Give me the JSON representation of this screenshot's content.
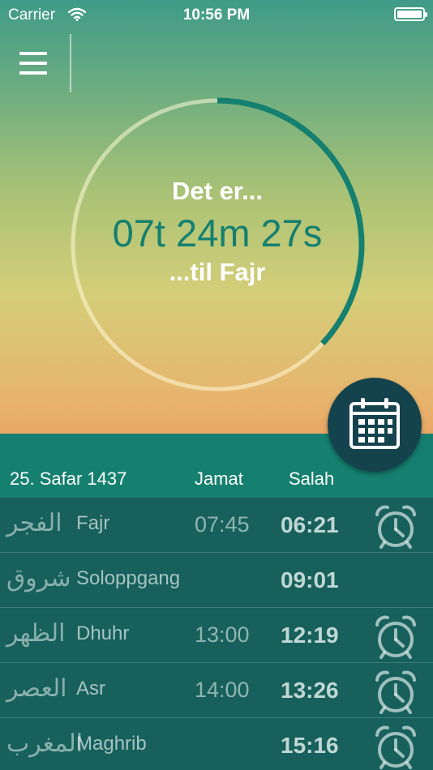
{
  "status_bar": {
    "carrier": "Carrier",
    "time": "10:56 PM",
    "wifi_icon": "wifi-icon",
    "battery_icon": "battery-icon"
  },
  "menu": {
    "icon": "hamburger-menu-icon"
  },
  "countdown": {
    "prefix": "Det er...",
    "remaining": "07t 24m 27s",
    "suffix": "...til Fajr",
    "progress_fraction": 0.37,
    "ring_color": "#15806f"
  },
  "calendar_button": {
    "icon": "calendar-icon",
    "color": "#14434e"
  },
  "list_header": {
    "date": "25. Safar 1437",
    "jamat": "Jamat",
    "salah": "Salah"
  },
  "prayers": [
    {
      "arabic": "الفجر",
      "name": "Fajr",
      "jamat": "07:45",
      "salah": "06:21",
      "alarm": true
    },
    {
      "arabic": "شروق",
      "name": "Soloppgang",
      "jamat": "",
      "salah": "09:01",
      "alarm": false
    },
    {
      "arabic": "الظهر",
      "name": "Dhuhr",
      "jamat": "13:00",
      "salah": "12:19",
      "alarm": true
    },
    {
      "arabic": "العصر",
      "name": "Asr",
      "jamat": "14:00",
      "salah": "13:26",
      "alarm": true
    },
    {
      "arabic": "المغرب",
      "name": "Maghrib",
      "jamat": "",
      "salah": "15:16",
      "alarm": true
    }
  ],
  "colors": {
    "accent": "#15806f",
    "list_bg": "#17605b"
  }
}
